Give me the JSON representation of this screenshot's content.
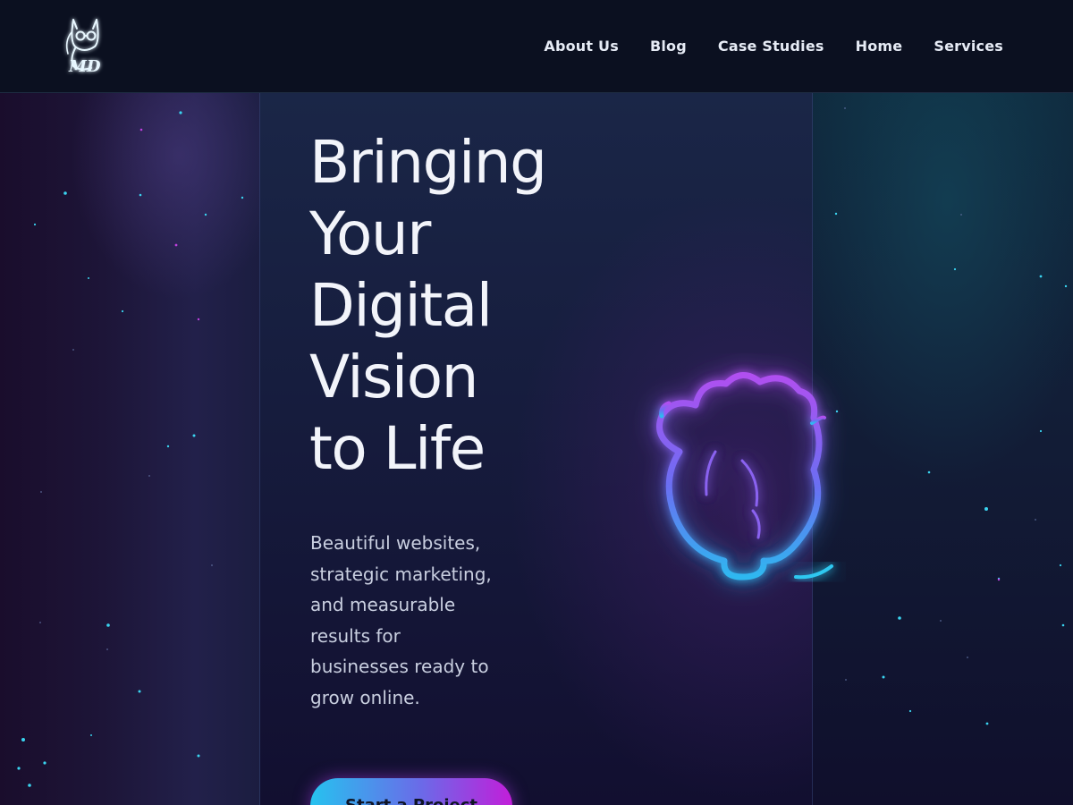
{
  "header": {
    "logo_text": "MD",
    "nav": [
      {
        "label": "About Us"
      },
      {
        "label": "Blog"
      },
      {
        "label": "Case Studies"
      },
      {
        "label": "Home"
      },
      {
        "label": "Services"
      }
    ]
  },
  "hero": {
    "title_lines": [
      "Bringing",
      "Your",
      "Digital",
      "Vision",
      "to Life"
    ],
    "subtitle_lines": [
      "Beautiful websites,",
      "strategic marketing,",
      "and measurable",
      "results for",
      "businesses ready to",
      "grow online."
    ],
    "cta_label": "Start a Project"
  },
  "colors": {
    "accent_cyan": "#26c2ef",
    "accent_magenta": "#c21ed9",
    "neon_purple": "#a34ff0",
    "neon_blue": "#3e8cf2",
    "header_bg": "#0b1020"
  },
  "icons": {
    "logo": "cat-with-glasses-logo",
    "illustration": "neon-brain-illustration"
  }
}
